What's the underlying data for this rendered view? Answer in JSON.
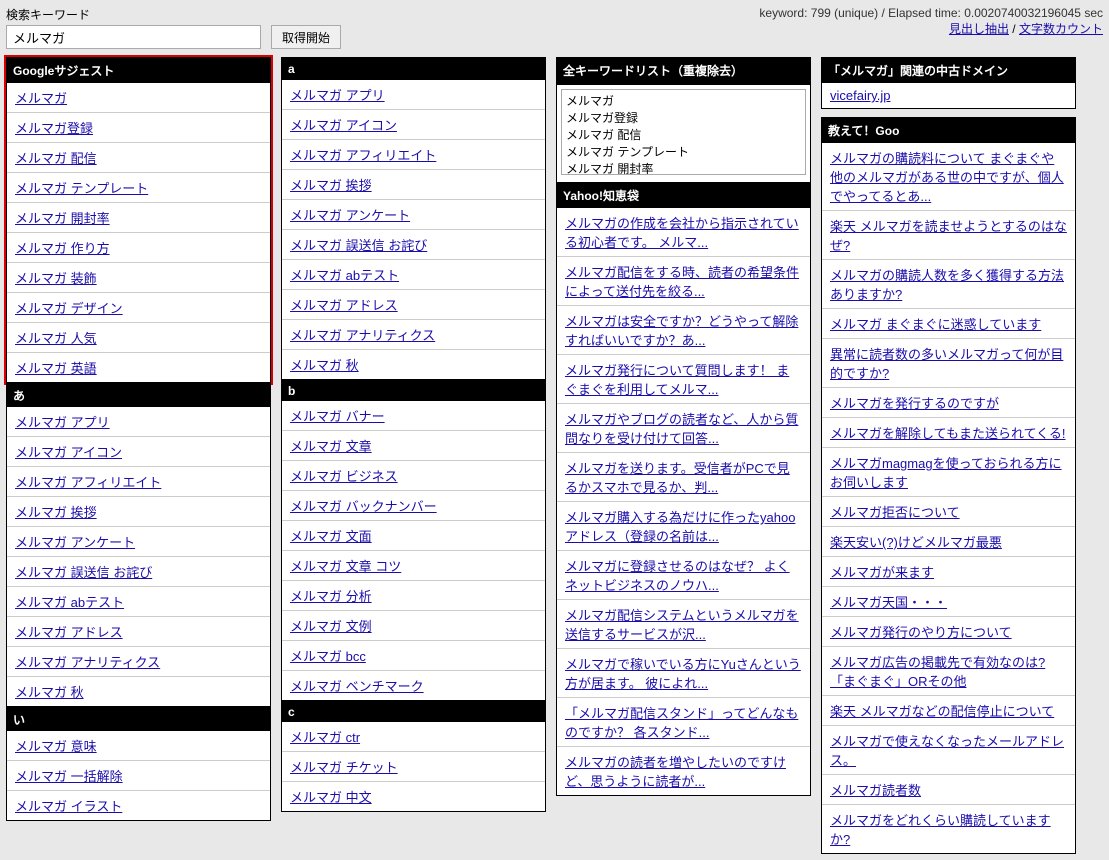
{
  "search": {
    "label": "検索キーワード",
    "value": "メルマガ",
    "button": "取得開始"
  },
  "stats": "keyword: 799 (unique) / Elapsed time: 0.0020740032196045 sec",
  "toplinks": {
    "a": "見出し抽出",
    "b": "文字数カウント"
  },
  "col1": {
    "google": {
      "title": "Googleサジェスト",
      "items": [
        "メルマガ",
        "メルマガ登録",
        "メルマガ 配信",
        "メルマガ テンプレート",
        "メルマガ 開封率",
        "メルマガ 作り方",
        "メルマガ 装飾",
        "メルマガ デザイン",
        "メルマガ 人気",
        "メルマガ 英語"
      ]
    },
    "a": {
      "title": "あ",
      "items": [
        "メルマガ アプリ",
        "メルマガ アイコン",
        "メルマガ アフィリエイト",
        "メルマガ 挨拶",
        "メルマガ アンケート",
        "メルマガ 誤送信 お詫び",
        "メルマガ abテスト",
        "メルマガ アドレス",
        "メルマガ アナリティクス",
        "メルマガ 秋"
      ]
    },
    "i": {
      "title": "い",
      "items": [
        "メルマガ 意味",
        "メルマガ 一括解除",
        "メルマガ イラスト"
      ]
    }
  },
  "col2": {
    "a_alpha": {
      "title": "a",
      "items": [
        "メルマガ アプリ",
        "メルマガ アイコン",
        "メルマガ アフィリエイト",
        "メルマガ 挨拶",
        "メルマガ アンケート",
        "メルマガ 誤送信 お詫び",
        "メルマガ abテスト",
        "メルマガ アドレス",
        "メルマガ アナリティクス",
        "メルマガ 秋"
      ]
    },
    "b_alpha": {
      "title": "b",
      "items": [
        "メルマガ バナー",
        "メルマガ 文章",
        "メルマガ ビジネス",
        "メルマガ バックナンバー",
        "メルマガ 文面",
        "メルマガ 文章 コツ",
        "メルマガ 分析",
        "メルマガ 文例",
        "メルマガ bcc",
        "メルマガ ベンチマーク"
      ]
    },
    "c_alpha": {
      "title": "c",
      "items": [
        "メルマガ ctr",
        "メルマガ チケット",
        "メルマガ 中文"
      ]
    }
  },
  "col3": {
    "all": {
      "title": "全キーワードリスト（重複除去）"
    },
    "textarea": "メルマガ\nメルマガ登録\nメルマガ 配信\nメルマガ テンプレート\nメルマガ 開封率",
    "yahoo": {
      "title": "Yahoo!知恵袋",
      "items": [
        "メルマガの作成を会社から指示されている初心者です。 メルマ...",
        "メルマガ配信をする時、読者の希望条件によって送付先を絞る...",
        "メルマガは安全ですか？どうやって解除すればいいですか？あ...",
        "メルマガ発行について質問します！ まぐまぐを利用してメルマ...",
        "メルマガやブログの読者など、人から質問なりを受け付けて回答...",
        "メルマガを送ります。受信者がPCで見るかスマホで見るか、判...",
        "メルマガ購入する為だけに作ったyahooアドレス（登録の名前は...",
        "メルマガに登録させるのはなぜ？ よくネットビジネスのノウハ...",
        "メルマガ配信システムというメルマガを送信するサービスが沢...",
        "メルマガで稼いでいる方にYuさんという方が居ます。 彼によれ...",
        "「メルマガ配信スタンド」ってどんなものですか？ 各スタンド...",
        "メルマガの読者を増やしたいのですけど、思うように読者が..."
      ]
    }
  },
  "col4": {
    "domain": {
      "title": "「メルマガ」関連の中古ドメイン",
      "items": [
        "vicefairy.jp"
      ]
    },
    "goo": {
      "title": "教えて！Goo",
      "items": [
        "メルマガの購読料について まぐまぐや他のメルマガがある世の中ですが、個人でやってるとあ...",
        "楽天 メルマガを読ませようとするのはなぜ?",
        "メルマガの購読人数を多く獲得する方法ありますか?",
        "メルマガ まぐまぐに迷惑しています",
        "異常に読者数の多いメルマガって何が目的ですか?",
        "メルマガを発行するのですが",
        "メルマガを解除してもまた送られてくる!",
        "メルマガmagmagを使っておられる方にお伺いします",
        "メルマガ拒否について",
        "楽天安い(?)けどメルマガ最悪",
        "メルマガが来ます",
        "メルマガ天国・・・",
        "メルマガ発行のやり方について",
        "メルマガ広告の掲載先で有効なのは?「まぐまぐ」ORその他",
        "楽天 メルマガなどの配信停止について",
        "メルマガで使えなくなったメールアドレス。",
        "メルマガ読者数",
        "メルマガをどれくらい購読していますか?"
      ]
    }
  }
}
